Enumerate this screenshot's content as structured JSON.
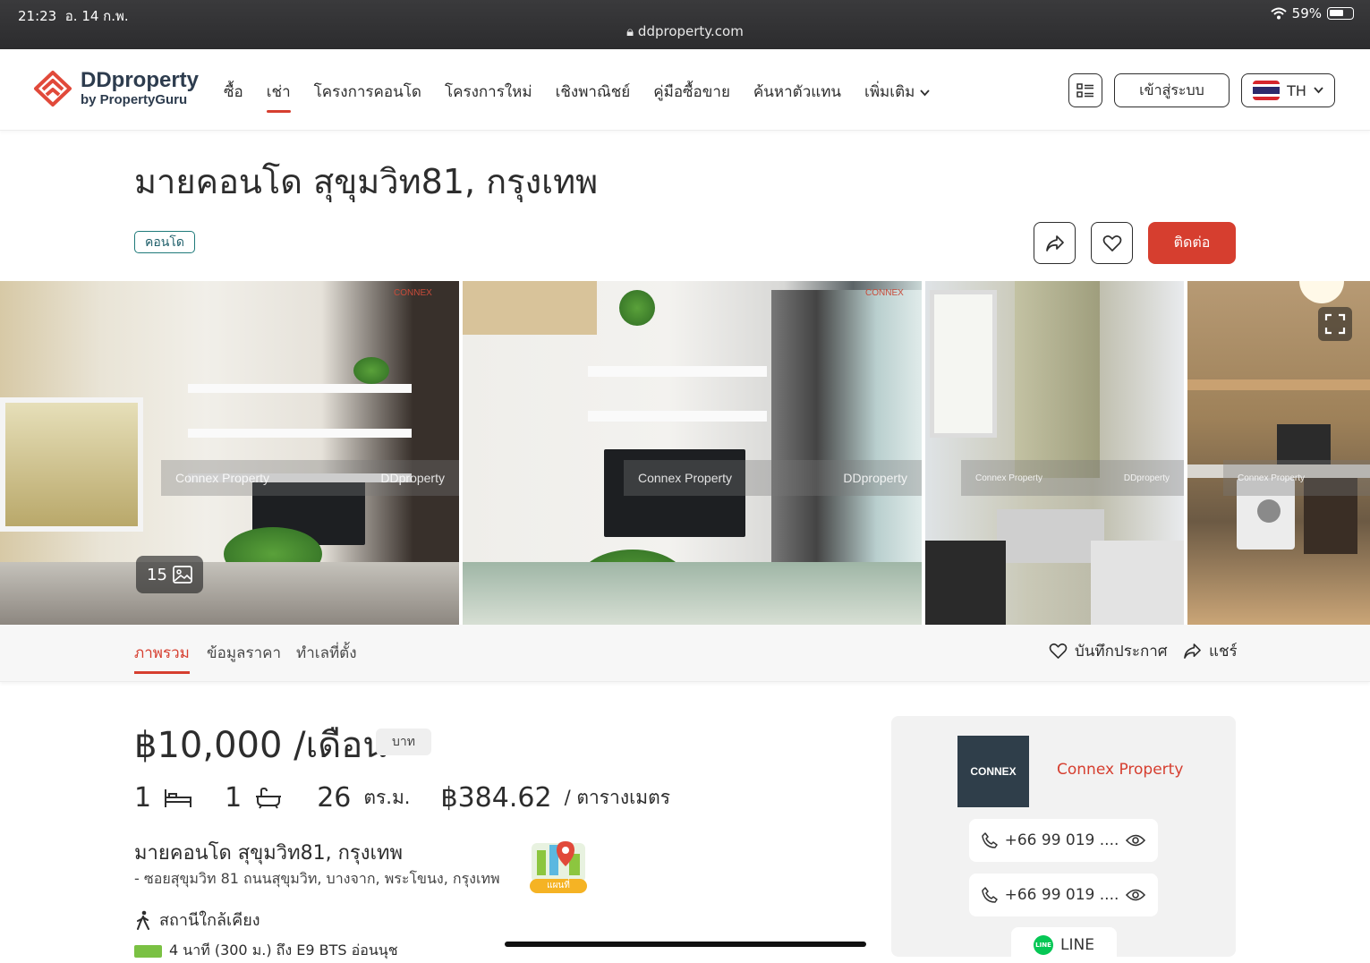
{
  "status_bar": {
    "time": "21:23",
    "date": "อ. 14 ก.พ.",
    "battery": "59%",
    "url": "ddproperty.com"
  },
  "nav": {
    "logo_main": "DDproperty",
    "logo_sub": "by PropertyGuru",
    "items": [
      "ซื้อ",
      "เช่า",
      "โครงการคอนโด",
      "โครงการใหม่",
      "เชิงพาณิชย์",
      "คู่มือซื้อขาย",
      "ค้นหาตัวแทน",
      "เพิ่มเติม"
    ],
    "active_item": "เช่า",
    "login": "เข้าสู่ระบบ",
    "language": "TH"
  },
  "listing": {
    "title": "มายคอนโด สุขุมวิท81, กรุงเทพ",
    "tag": "คอนโด",
    "contact_button": "ติดต่อ",
    "photo_count": "15",
    "watermarks": [
      "Connex Property",
      "DDproperty",
      "CONNEX"
    ]
  },
  "tabs": {
    "items": [
      "ภาพรวม",
      "ข้อมูลราคา",
      "ทำเลที่ตั้ง"
    ],
    "save": "บันทึกประกาศ",
    "share": "แชร์"
  },
  "details": {
    "price": "฿10,000 /เดือน",
    "currency": "บาท",
    "bedrooms": "1",
    "bathrooms": "1",
    "area_value": "26",
    "area_unit": "ตร.ม.",
    "price_per_sqm": "฿384.62",
    "price_per_sqm_unit": "/ ตารางเมตร",
    "project_name": "มายคอนโด สุขุมวิท81, กรุงเทพ",
    "address": "- ซอยสุขุมวิท 81 ถนนสุขุมวิท, บางจาก, พระโขนง, กรุงเทพ",
    "map_label": "แผนที่",
    "stations_heading": "สถานีใกล้เคียง",
    "station_1": "4 นาที (300 ม.) ถึง E9 BTS อ่อนนุช"
  },
  "agent": {
    "logo_text": "CONNEX",
    "name": "Connex Property",
    "phone_1": "+66 99 019 ....",
    "phone_2": "+66 99 019 ....",
    "line": "LINE"
  },
  "colors": {
    "brand_red": "#d63e2f",
    "tag_teal": "#1f7a7a",
    "line_green": "#06c755",
    "bts_green": "#7ac143"
  }
}
